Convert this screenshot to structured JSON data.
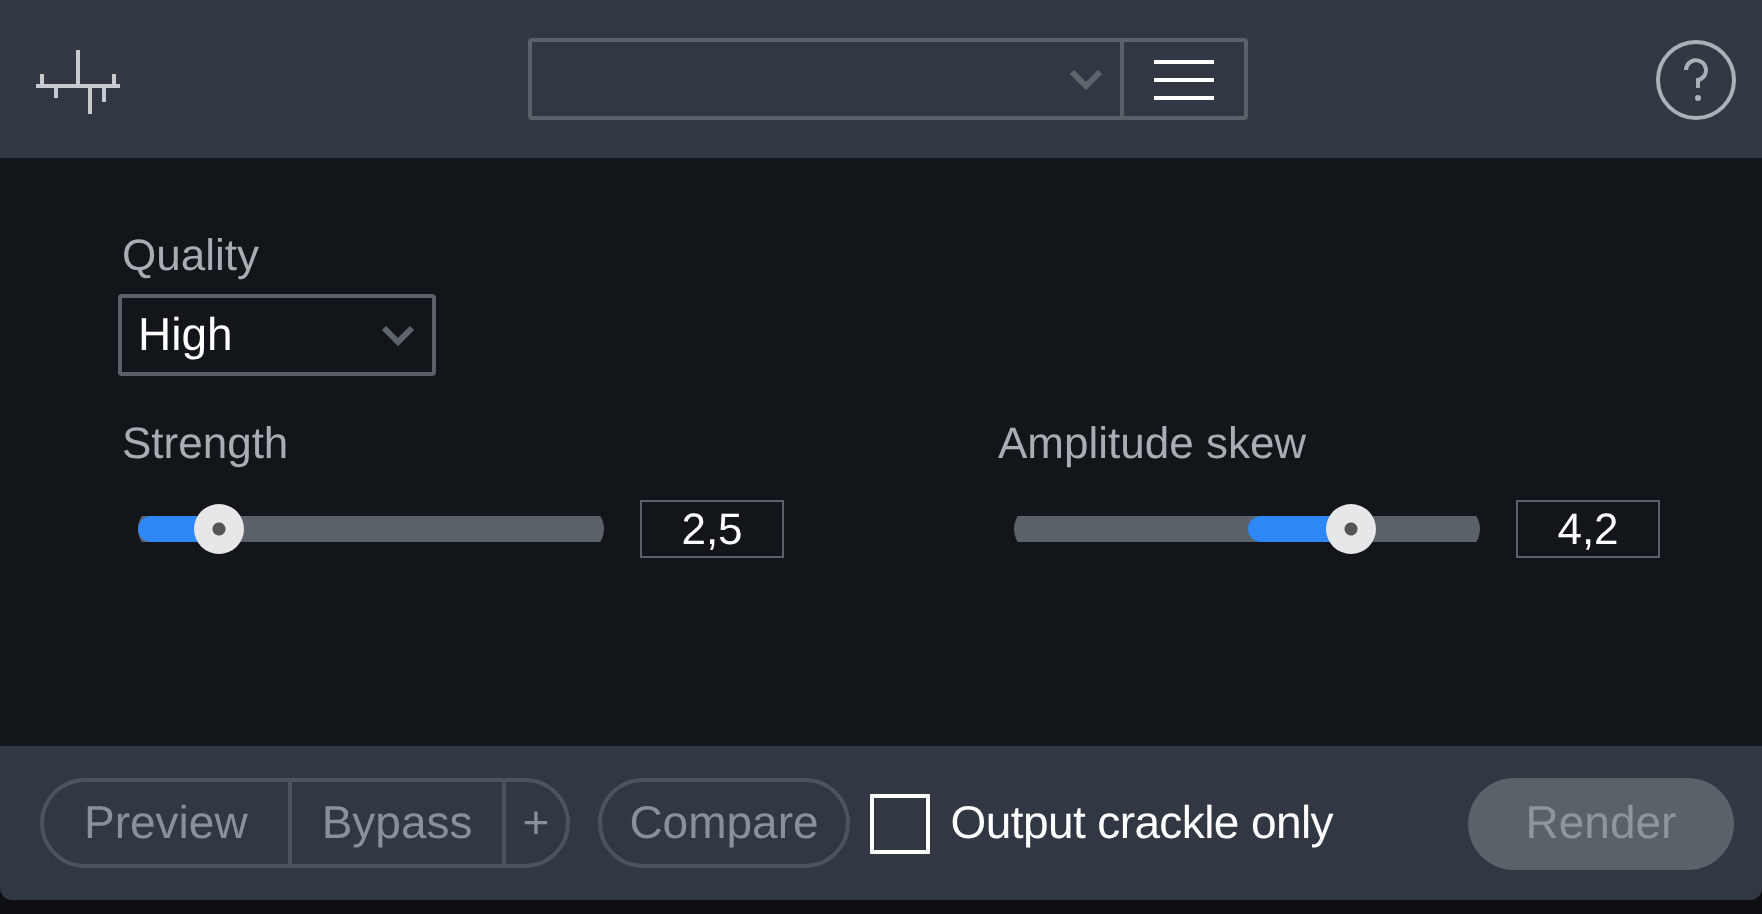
{
  "quality": {
    "label": "Quality",
    "value": "High"
  },
  "sliders": [
    {
      "label": "Strength",
      "kind": "unipolar",
      "level": 0.17,
      "reading": "2,5"
    },
    {
      "label": "Amplitude skew",
      "kind": "bipolar",
      "level": 0.72,
      "reading": "4,2"
    }
  ],
  "footer": {
    "preview": "Preview",
    "bypass": "Bypass",
    "plus": "+",
    "compare": "Compare",
    "checkbox": {
      "label": "Output crackle only",
      "checked": false
    },
    "render": "Render"
  }
}
